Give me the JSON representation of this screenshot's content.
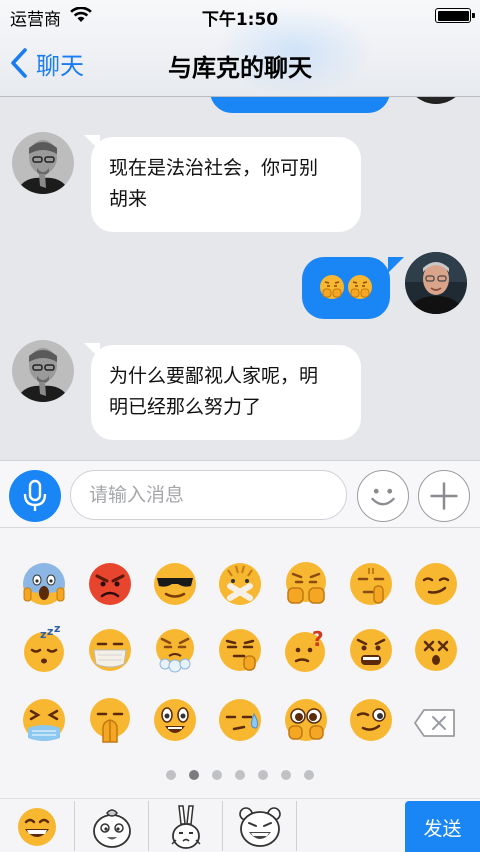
{
  "status_bar": {
    "carrier": "运营商",
    "time": "下午1:50"
  },
  "nav": {
    "back_label": "聊天",
    "title": "与库克的聊天"
  },
  "messages": [
    {
      "side": "left",
      "sender": "jobs",
      "text_line1": "现在是法治社会，你可别",
      "text_line2": "胡来"
    },
    {
      "side": "right",
      "sender": "cook",
      "content": "emoji",
      "emojis": [
        "fist-face",
        "fist-face"
      ]
    },
    {
      "side": "left",
      "sender": "jobs",
      "text_line1": "为什么要鄙视人家呢，明",
      "text_line2": "明已经那么努力了"
    }
  ],
  "input": {
    "placeholder": "请输入消息",
    "value": ""
  },
  "emoji_grid": [
    [
      "scream",
      "angry-red",
      "sunglasses",
      "mouth-taped",
      "fist-face",
      "shush",
      "smirk"
    ],
    [
      "sleeping",
      "mask",
      "crying-steam",
      "thinking",
      "confused",
      "fearful",
      "dizzy"
    ],
    [
      "weary-cold",
      "praying",
      "starry-eyed",
      "sweat",
      "pleading",
      "wink"
    ]
  ],
  "pager": {
    "count": 7,
    "active_index": 1
  },
  "bottom_tabs": [
    "classic-smile",
    "chick-sticker",
    "bunny-sticker",
    "bear-sticker"
  ],
  "send_label": "发送",
  "colors": {
    "accent": "#1a86f5",
    "chat_bg": "#e6e7eb",
    "emoji_yellow": "#f7b731"
  }
}
